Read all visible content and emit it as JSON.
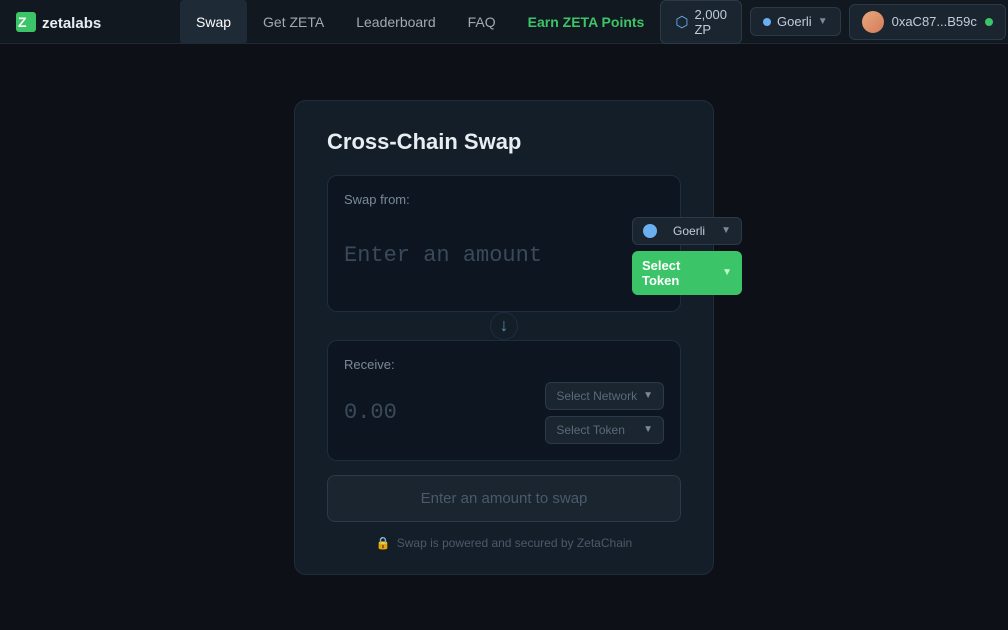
{
  "nav": {
    "logo_alt": "ZetaLabs",
    "links": [
      {
        "label": "Swap",
        "active": true,
        "highlight": false
      },
      {
        "label": "Get ZETA",
        "active": false,
        "highlight": false
      },
      {
        "label": "Leaderboard",
        "active": false,
        "highlight": false
      },
      {
        "label": "FAQ",
        "active": false,
        "highlight": false
      },
      {
        "label": "Earn ZETA Points",
        "active": false,
        "highlight": true
      }
    ],
    "zp_balance": "2,000 ZP",
    "network": "Goerli",
    "wallet_address": "0xaC87...B59c"
  },
  "card": {
    "title": "Cross-Chain Swap",
    "swap_from_label": "Swap from:",
    "amount_placeholder": "Enter an amount",
    "from_network": "Goerli",
    "from_token_label": "Select Token",
    "arrow": "↓",
    "receive_label": "Receive:",
    "receive_amount": "0.00",
    "to_network_label": "Select Network",
    "to_token_label": "Select Token",
    "swap_button_label": "Enter an amount to swap",
    "powered_by": "Swap is powered and secured by ZetaChain"
  }
}
